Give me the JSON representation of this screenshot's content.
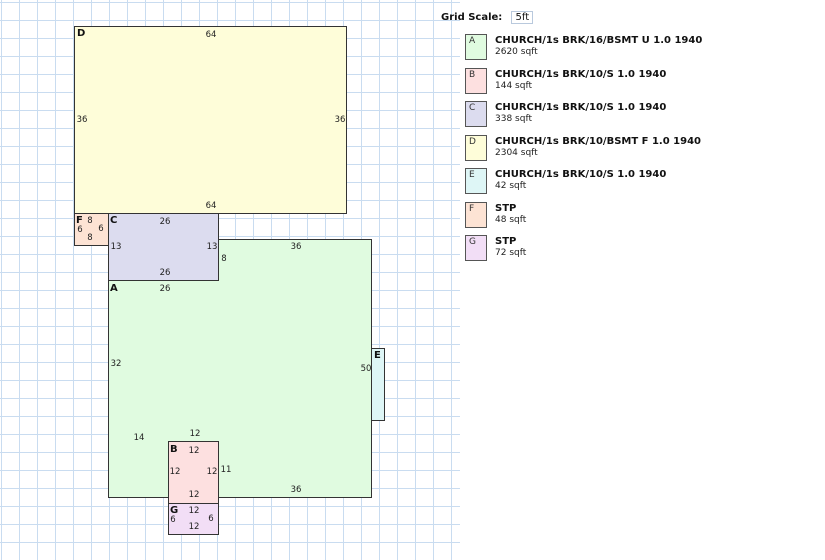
{
  "grid_scale": {
    "label": "Grid Scale:",
    "value": "5ft"
  },
  "areas": [
    {
      "id": "D",
      "title": "CHURCH/1s BRK/10/BSMT F 1.0 1940",
      "area": "2304 sqft",
      "color": "#fefdd9"
    },
    {
      "id": "F",
      "title": "STP",
      "area": "48 sqft",
      "color": "#fde3d4"
    },
    {
      "id": "C",
      "title": "CHURCH/1s BRK/10/S 1.0 1940",
      "area": "338 sqft",
      "color": "#dcdcef"
    },
    {
      "id": "A",
      "title": "CHURCH/1s BRK/16/BSMT U 1.0 1940",
      "area": "2620 sqft",
      "color": "#e0fbe0"
    },
    {
      "id": "E",
      "title": "CHURCH/1s BRK/10/S 1.0 1940",
      "area": "42 sqft",
      "color": "#def6f6"
    },
    {
      "id": "B",
      "title": "CHURCH/1s BRK/10/S 1.0 1940",
      "area": "144 sqft",
      "color": "#fde0e0"
    },
    {
      "id": "G",
      "title": "STP",
      "area": "72 sqft",
      "color": "#f2def6"
    }
  ],
  "legend": [
    {
      "id": "A",
      "title": "CHURCH/1s BRK/16/BSMT U 1.0 1940",
      "area": "2620 sqft",
      "color": "#e0fbe0"
    },
    {
      "id": "B",
      "title": "CHURCH/1s BRK/10/S 1.0 1940",
      "area": "144 sqft",
      "color": "#fde0e0"
    },
    {
      "id": "C",
      "title": "CHURCH/1s BRK/10/S 1.0 1940",
      "area": "338 sqft",
      "color": "#dcdcef"
    },
    {
      "id": "D",
      "title": "CHURCH/1s BRK/10/BSMT F 1.0 1940",
      "area": "2304 sqft",
      "color": "#fefdd9"
    },
    {
      "id": "E",
      "title": "CHURCH/1s BRK/10/S 1.0 1940",
      "area": "42 sqft",
      "color": "#def6f6"
    },
    {
      "id": "F",
      "title": "STP",
      "area": "48 sqft",
      "color": "#fde3d4"
    },
    {
      "id": "G",
      "title": "STP",
      "area": "72 sqft",
      "color": "#f2def6"
    }
  ],
  "dimensions": {
    "D": [
      "64",
      "36",
      "36",
      "64"
    ],
    "F": [
      "8",
      "6",
      "6",
      "8"
    ],
    "C": [
      "26",
      "13",
      "13",
      "26"
    ],
    "A": [
      "26",
      "36",
      "8",
      "32",
      "50",
      "14",
      "12",
      "11",
      "36"
    ],
    "B": [
      "12",
      "12",
      "12",
      "12"
    ],
    "G": [
      "12",
      "6",
      "6",
      "12"
    ]
  }
}
